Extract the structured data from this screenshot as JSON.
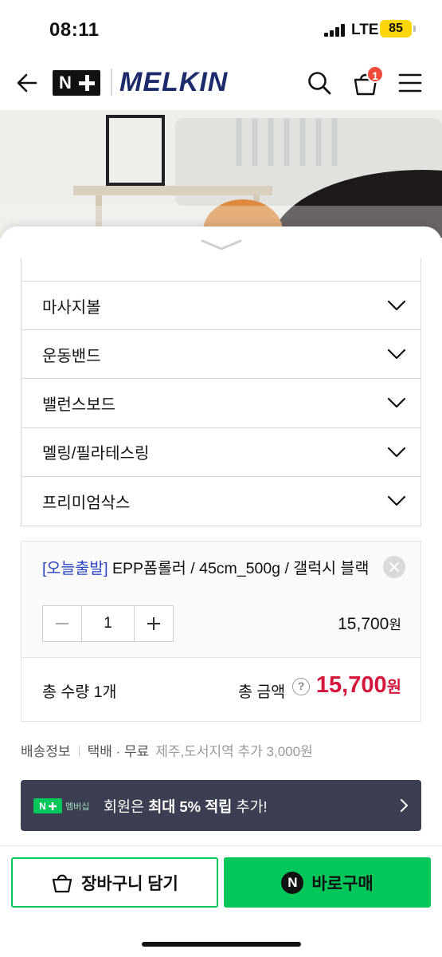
{
  "status_bar": {
    "time": "08:11",
    "network": "LTE",
    "battery": "85"
  },
  "header": {
    "brand": "MELKIN",
    "cart_count": "1"
  },
  "options": [
    {
      "label": "마사지볼"
    },
    {
      "label": "운동밴드"
    },
    {
      "label": "밸런스보드"
    },
    {
      "label": "멜링/필라테스링"
    },
    {
      "label": "프리미엄삭스"
    }
  ],
  "selected_item": {
    "tag": "[오늘출발]",
    "name": " EPP폼롤러 / 45cm_500g / 갤럭시 블랙",
    "quantity": "1",
    "price": "15,700",
    "price_unit": "원"
  },
  "total": {
    "qty_label": "총 수량 ",
    "qty_value": "1",
    "qty_unit": "개",
    "amount_label": "총 금액",
    "amount": "15,700",
    "amount_unit": "원"
  },
  "shipping": {
    "label": "배송정보",
    "method": "택배 · 무료",
    "extra": "제주,도서지역 추가 3,000원"
  },
  "membership": {
    "badge": "멤버십",
    "text_pre": "회원은 ",
    "text_bold": "최대 5% 적립",
    "text_post": " 추가!"
  },
  "actions": {
    "cart_label": "장바구니 담기",
    "buy_label": "바로구매",
    "buy_icon_letter": "N"
  },
  "colors": {
    "accent_green": "#03c75a",
    "price_red": "#d4163c",
    "brand_navy": "#1c2b6b",
    "badge_red": "#f04a3b"
  }
}
